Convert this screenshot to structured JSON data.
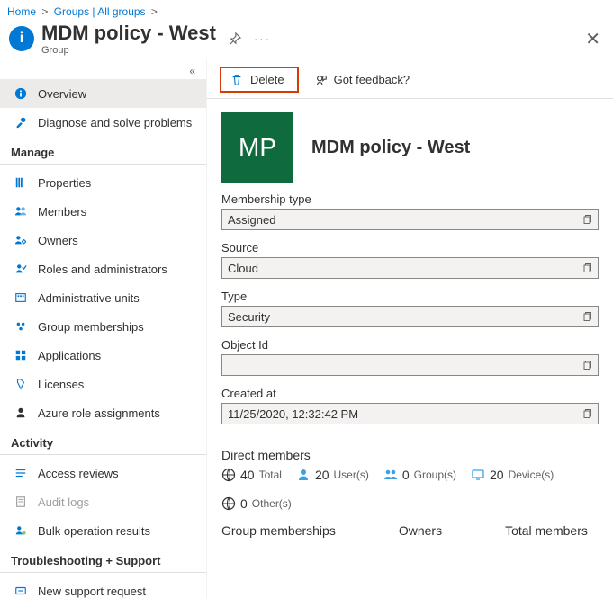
{
  "breadcrumb": {
    "home": "Home",
    "groups": "Groups | All groups"
  },
  "header": {
    "title": "MDM policy - West",
    "subtitle": "Group"
  },
  "sidebar": {
    "overview": "Overview",
    "diagnose": "Diagnose and solve problems",
    "h_manage": "Manage",
    "properties": "Properties",
    "members": "Members",
    "owners": "Owners",
    "roles": "Roles and administrators",
    "adminunits": "Administrative units",
    "memberships": "Group memberships",
    "applications": "Applications",
    "licenses": "Licenses",
    "azureroles": "Azure role assignments",
    "h_activity": "Activity",
    "accessreviews": "Access reviews",
    "auditlogs": "Audit logs",
    "bulk": "Bulk operation results",
    "h_support": "Troubleshooting + Support",
    "newsupport": "New support request"
  },
  "toolbar": {
    "delete": "Delete",
    "feedback": "Got feedback?"
  },
  "detail": {
    "avatar_initials": "MP",
    "title": "MDM policy - West"
  },
  "fields": {
    "membership_label": "Membership type",
    "membership_value": "Assigned",
    "source_label": "Source",
    "source_value": "Cloud",
    "type_label": "Type",
    "type_value": "Security",
    "objectid_label": "Object Id",
    "objectid_value": "",
    "created_label": "Created at",
    "created_value": "11/25/2020, 12:32:42 PM"
  },
  "direct": {
    "heading": "Direct members",
    "total_n": "40",
    "total_l": "Total",
    "users_n": "20",
    "users_l": "User(s)",
    "groups_n": "0",
    "groups_l": "Group(s)",
    "devices_n": "20",
    "devices_l": "Device(s)",
    "others_n": "0",
    "others_l": "Other(s)"
  },
  "bottom": {
    "memberships": "Group memberships",
    "owners": "Owners",
    "total": "Total members"
  }
}
